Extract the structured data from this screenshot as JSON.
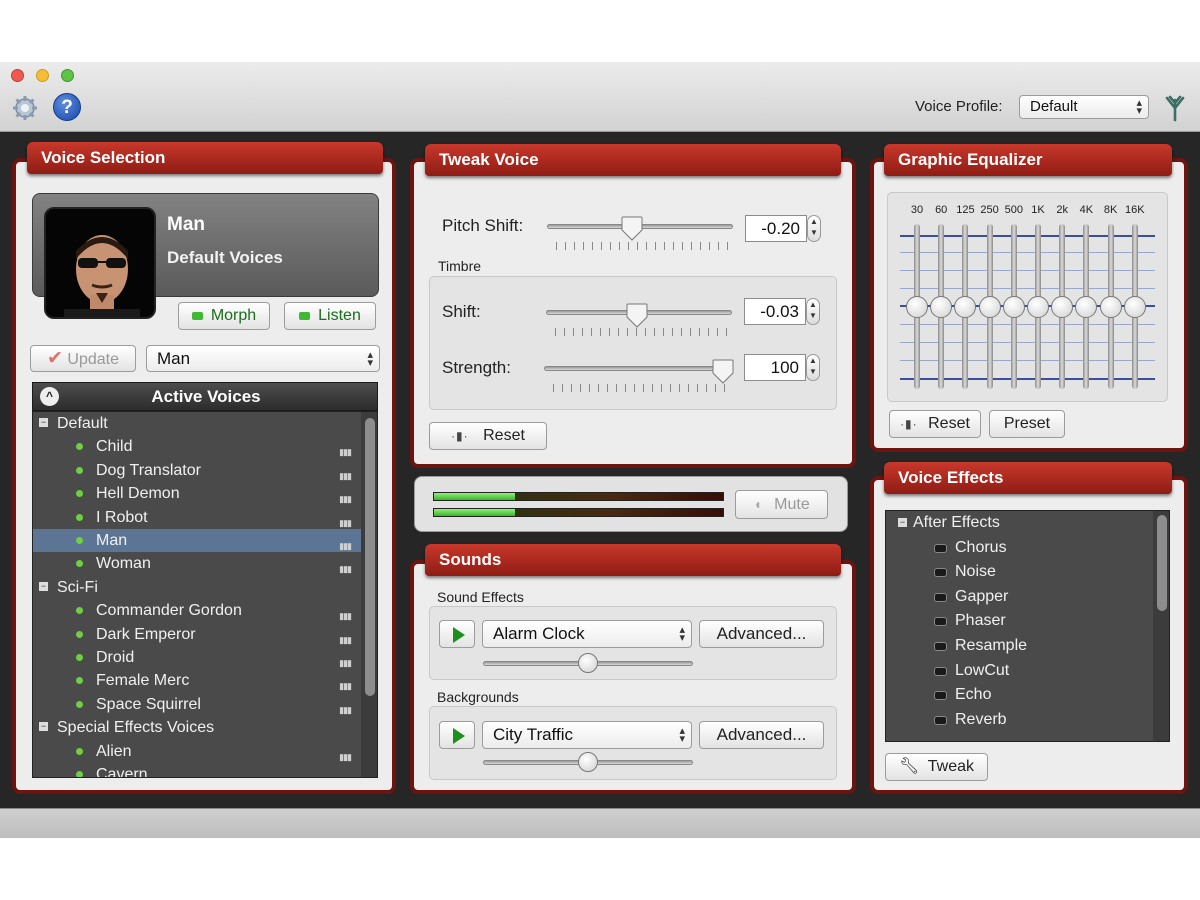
{
  "toolbar": {
    "voice_profile_label": "Voice Profile:",
    "voice_profile_value": "Default"
  },
  "voice_selection": {
    "title": "Voice Selection",
    "current_voice_name": "Man",
    "current_voice_group": "Default Voices",
    "morph_label": "Morph",
    "listen_label": "Listen",
    "update_label": "Update",
    "voice_dropdown": "Man",
    "list_header": "Active Voices",
    "groups": [
      {
        "name": "Default",
        "items": [
          "Child",
          "Dog Translator",
          "Hell Demon",
          "I Robot",
          "Man",
          "Woman"
        ]
      },
      {
        "name": "Sci-Fi",
        "items": [
          "Commander Gordon",
          "Dark Emperor",
          "Droid",
          "Female Merc",
          "Space Squirrel"
        ]
      },
      {
        "name": "Special Effects Voices",
        "items": [
          "Alien",
          "Cavern"
        ]
      }
    ],
    "selected_item": "Man"
  },
  "tweak_voice": {
    "title": "Tweak Voice",
    "pitch_label": "Pitch Shift:",
    "pitch_value": "-0.20",
    "timbre_label": "Timbre",
    "shift_label": "Shift:",
    "shift_value": "-0.03",
    "strength_label": "Strength:",
    "strength_value": "100",
    "reset_label": "Reset"
  },
  "meter": {
    "mute_label": "Mute",
    "level_top": 0.28,
    "level_bottom": 0.28
  },
  "sounds": {
    "title": "Sounds",
    "effects_label": "Sound Effects",
    "effect_value": "Alarm Clock",
    "advanced_label": "Advanced...",
    "backgrounds_label": "Backgrounds",
    "background_value": "City Traffic",
    "advanced2_label": "Advanced..."
  },
  "equalizer": {
    "title": "Graphic Equalizer",
    "bands": [
      "30",
      "60",
      "125",
      "250",
      "500",
      "1K",
      "2k",
      "4K",
      "8K",
      "16K"
    ],
    "reset_label": "Reset",
    "preset_label": "Preset"
  },
  "voice_effects": {
    "title": "Voice Effects",
    "group": "After Effects",
    "items": [
      "Chorus",
      "Noise",
      "Gapper",
      "Phaser",
      "Resample",
      "LowCut",
      "Echo",
      "Reverb"
    ],
    "tweak_label": "Tweak"
  },
  "colors": {
    "panel_title_red": "#b32a20",
    "panel_border": "#6b1410",
    "selection_blue": "#5c7594",
    "active_green": "#6fcf43"
  }
}
